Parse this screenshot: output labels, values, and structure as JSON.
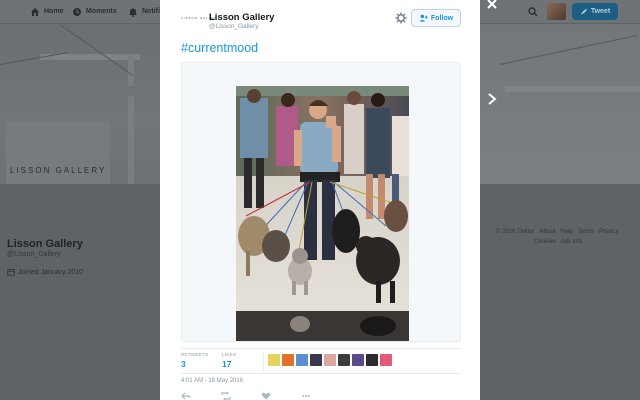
{
  "topnav": {
    "home_label": "Home",
    "moments_label": "Moments",
    "notifications_label": "Notific",
    "tweet_label": "Tweet",
    "icons": [
      "home-icon",
      "moments-icon",
      "bell-icon",
      "search-icon",
      "feather-icon"
    ]
  },
  "profile": {
    "logo_text": "LISSON GALLERY",
    "name": "Lisson Gallery",
    "handle": "@Lisson_Gallery",
    "joined": "Joined January 2010"
  },
  "footer": {
    "links": [
      "© 2016 Twitter",
      "About",
      "Help",
      "Terms",
      "Privacy",
      "Cookies",
      "Ads info"
    ]
  },
  "tweet": {
    "author_name": "Lisson Gallery",
    "author_handle": "@Lisson_Gallery",
    "author_logo": "LISSON GALLERY",
    "follow_label": "Follow",
    "text": "#currentmood",
    "retweets_label": "RETWEETS",
    "retweets": "3",
    "likes_label": "LIKES",
    "likes": "17",
    "timestamp": "4:01 AM - 18 May 2016",
    "liker_colors": [
      "#e8d35a",
      "#e0702a",
      "#5a8fd0",
      "#3b3550",
      "#d9a8a0",
      "#3a3a3a",
      "#5a4a8a",
      "#2b2b2b",
      "#e25a7a"
    ]
  },
  "colors": {
    "accent": "#1b95e0",
    "overlay": "#5b6066"
  }
}
